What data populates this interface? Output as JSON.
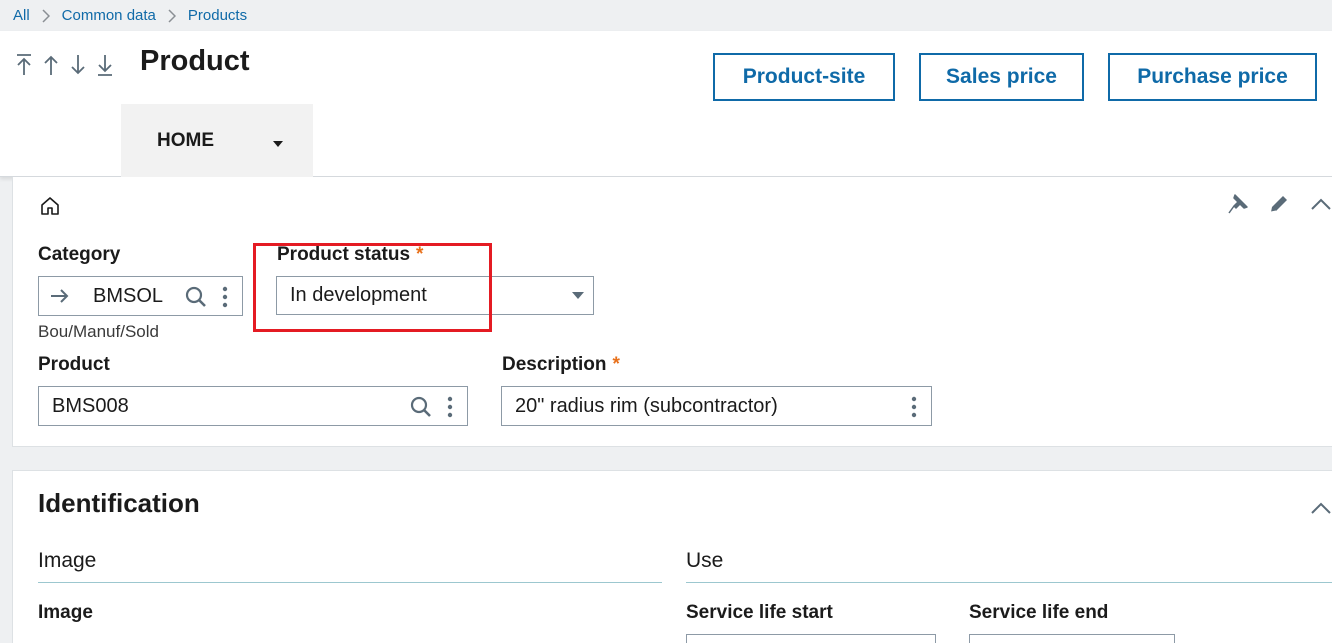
{
  "breadcrumb": {
    "items": [
      "All",
      "Common data",
      "Products"
    ]
  },
  "header": {
    "title": "Product",
    "nav": [
      "first-record-icon",
      "previous-record-icon",
      "next-record-icon",
      "last-record-icon"
    ],
    "buttons": {
      "product_site": "Product-site",
      "sales_price": "Sales price",
      "purchase_price": "Purchase price"
    },
    "home_tab": "HOME"
  },
  "main_card": {
    "category": {
      "label": "Category",
      "value": "BMSOL",
      "helper": "Bou/Manuf/Sold"
    },
    "product_status": {
      "label": "Product status",
      "required_mark": "*",
      "value": "In development"
    },
    "product": {
      "label": "Product",
      "value": "BMS008"
    },
    "description": {
      "label": "Description",
      "required_mark": "*",
      "value": "20\" radius rim (subcontractor)"
    }
  },
  "identification": {
    "title": "Identification",
    "image_section": "Image",
    "use_section": "Use",
    "image_label": "Image",
    "service_life_start": "Service life start",
    "service_life_end": "Service life end"
  },
  "colors": {
    "accent": "#0f6aa8",
    "required": "#e8701a",
    "highlight": "#e41b23"
  }
}
